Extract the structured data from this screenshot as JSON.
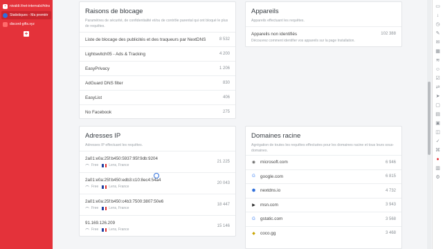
{
  "tabs": [
    {
      "label": "nivaldi://net-internals/#dns",
      "icon": "square-tab-icon"
    },
    {
      "label": "Statistiques - Ma premièr",
      "icon": "nextdns-shield-icon"
    },
    {
      "label": "discord-gifts.xyz",
      "icon": "page-tab-icon"
    }
  ],
  "new_tab_label": "+",
  "blocklists": {
    "title": "Raisons de blocage",
    "subtitle": "Paramètres de sécurité, de confidentialité et/ou de contrôle parental qui ont bloqué le plus de requêtes.",
    "rows": [
      {
        "name": "Liste de blocage des publicités et des traqueurs par NextDNS",
        "count": "8 532"
      },
      {
        "name": "Lightswitch05 - Ads & Tracking",
        "count": "4 200"
      },
      {
        "name": "EasyPrivacy",
        "count": "1 206"
      },
      {
        "name": "AdGuard DNS filter",
        "count": "830"
      },
      {
        "name": "EasyList",
        "count": "406"
      },
      {
        "name": "No Facebook",
        "count": "275"
      }
    ]
  },
  "devices": {
    "title": "Appareils",
    "subtitle": "Appareils effectuant les requêtes.",
    "row_name": "Appareils non identifiés",
    "row_count": "102 388",
    "row_hint": "Découvrez comment identifier vos appareils sur la page Installation."
  },
  "ips": {
    "title": "Adresses IP",
    "subtitle": "Adresses IP effectuant les requêtes.",
    "rows": [
      {
        "ip": "2a01:e0a:25f:b450:5937:95f:9db:9204",
        "isp": "Free",
        "location": "Lens, France",
        "count": "21 225"
      },
      {
        "ip": "2a01:e0a:25f:b450:edb3:c10:8ec4:54a4",
        "isp": "Free",
        "location": "Lens, France",
        "count": "20 043"
      },
      {
        "ip": "2a01:e0a:25f:b450:c4b3:7500:3807:50e6",
        "isp": "Free",
        "location": "Lens, France",
        "count": "18 447"
      },
      {
        "ip": "91.169.126.209",
        "isp": "Free",
        "location": "Lens, France",
        "count": "15 146"
      }
    ]
  },
  "domains": {
    "title": "Domaines racine",
    "subtitle": "Agrégation de toutes les requêtes effectuées pour les domaines racine et tous leurs sous-domaines.",
    "rows": [
      {
        "domain": "microsoft.com",
        "count": "6 946",
        "icon": "microsoft-icon",
        "glyph": "◉",
        "color": "#666"
      },
      {
        "domain": "google.com",
        "count": "6 815",
        "icon": "google-icon",
        "glyph": "G",
        "color": "#4285f4"
      },
      {
        "domain": "nextdns.io",
        "count": "4 732",
        "icon": "nextdns-icon",
        "glyph": "⬢",
        "color": "#2f6fdb"
      },
      {
        "domain": "msn.com",
        "count": "3 943",
        "icon": "msn-icon",
        "glyph": "▶",
        "color": "#222"
      },
      {
        "domain": "gstatic.com",
        "count": "3 568",
        "icon": "gstatic-icon",
        "glyph": "G",
        "color": "#4285f4"
      },
      {
        "domain": "coco.gg",
        "count": "3 468",
        "icon": "coco-icon",
        "glyph": "◆",
        "color": "#c9a400"
      }
    ]
  },
  "right_strip_icons": [
    "bookmark-icon",
    "download-icon",
    "history-icon",
    "notes-icon",
    "mail-icon",
    "calendar-icon",
    "feed-icon",
    "contacts-icon",
    "tasks-icon",
    "translate-icon",
    "send-icon",
    "window-icon",
    "reader-icon",
    "image-icon",
    "capture-icon",
    "checklist-icon",
    "code-icon",
    "vivaldi-icon",
    "panel-icon",
    "settings-icon"
  ],
  "colors": {
    "sidebar": "#e4323a",
    "accent": "#2f6fdb"
  }
}
